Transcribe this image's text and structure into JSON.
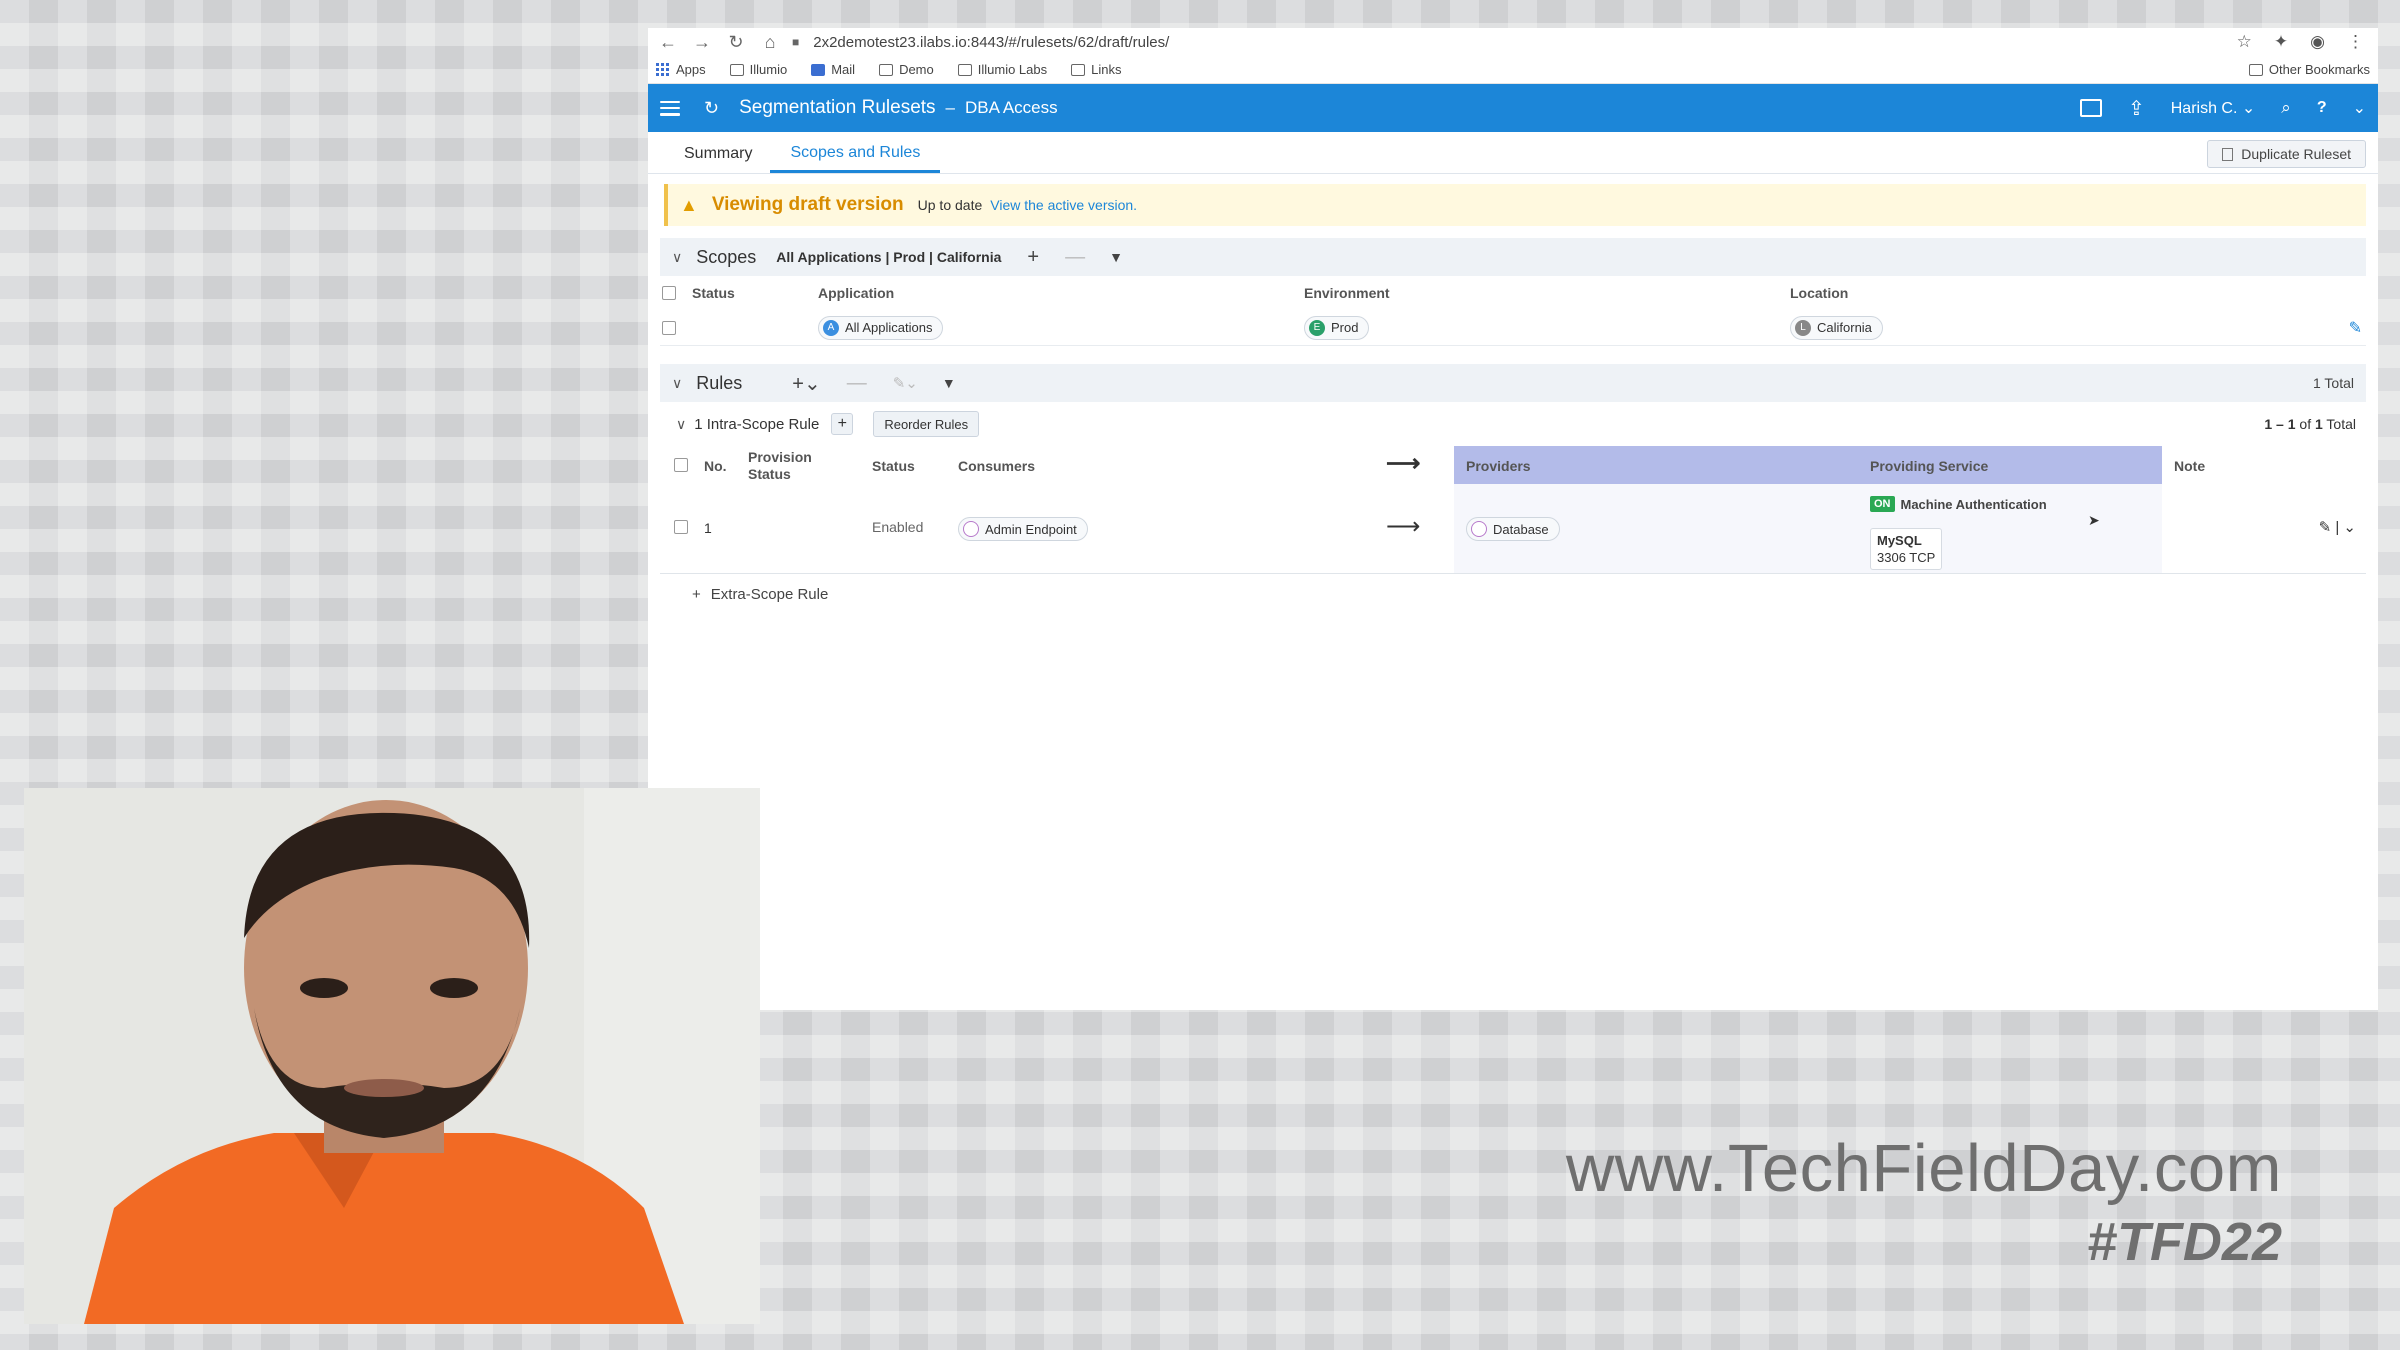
{
  "browser": {
    "url": "2x2demotest23.ilabs.io:8443/#/rulesets/62/draft/rules/",
    "bookmarks": [
      "Apps",
      "Illumio",
      "Mail",
      "Demo",
      "Illumio Labs",
      "Links"
    ],
    "other_bookmarks": "Other Bookmarks"
  },
  "header": {
    "title": "Segmentation Rulesets",
    "separator": "–",
    "subtitle": "DBA Access",
    "user": "Harish C."
  },
  "tabs": [
    "Summary",
    "Scopes and Rules"
  ],
  "duplicate_button": "Duplicate Ruleset",
  "banner": {
    "title": "Viewing draft version",
    "status": "Up to date",
    "link": "View the active version."
  },
  "scopes": {
    "title": "Scopes",
    "summary": "All Applications | Prod | California",
    "columns": [
      "Status",
      "Application",
      "Environment",
      "Location"
    ],
    "row": {
      "application": "All Applications",
      "environment": "Prod",
      "location": "California"
    }
  },
  "rules": {
    "title": "Rules",
    "total": "1 Total",
    "intra_label": "1 Intra-Scope Rule",
    "reorder": "Reorder Rules",
    "pagination": {
      "range": "1 – 1",
      "of": "of",
      "count": "1",
      "suffix": "Total"
    },
    "columns": {
      "no": "No.",
      "provision": "Provision Status",
      "status": "Status",
      "consumers": "Consumers",
      "providers": "Providers",
      "service": "Providing Service",
      "note": "Note"
    },
    "row": {
      "no": "1",
      "status": "Enabled",
      "consumer": "Admin Endpoint",
      "provider": "Database",
      "on_badge": "ON",
      "service_label": "Machine Authentication",
      "service_name": "MySQL",
      "service_port": "3306 TCP"
    },
    "extra_scope": "Extra-Scope Rule"
  },
  "watermark": {
    "url": "www.TechFieldDay.com",
    "tag": "#TFD22"
  },
  "colors": {
    "header_blue": "#1c86d8",
    "providers_band": "#b3bbe9",
    "warning_orange": "#d88c00",
    "on_green": "#2aa854"
  }
}
